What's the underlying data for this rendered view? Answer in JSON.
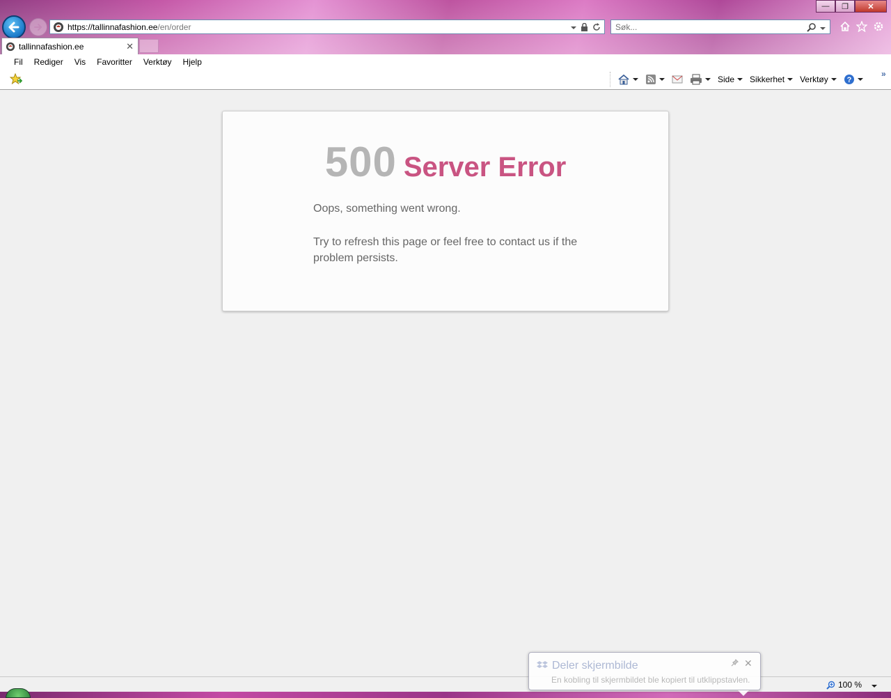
{
  "window": {
    "minimize_glyph": "—",
    "restore_glyph": "❐",
    "close_glyph": "✕"
  },
  "addressbar": {
    "url_host": "https://tallinnafashion.ee",
    "url_path": "/en/order"
  },
  "search": {
    "placeholder": "Søk..."
  },
  "tab": {
    "title": "tallinnafashion.ee",
    "close_glyph": "✕"
  },
  "menubar": {
    "items": [
      "Fil",
      "Rediger",
      "Vis",
      "Favoritter",
      "Verktøy",
      "Hjelp"
    ]
  },
  "commandbar": {
    "side": "Side",
    "security": "Sikkerhet",
    "tools": "Verktøy",
    "more_glyph": "»"
  },
  "page": {
    "error_code": "500",
    "error_title": "Server Error",
    "message_1": "Oops, something went wrong.",
    "message_2": "Try to refresh this page or feel free to contact us if the problem persists."
  },
  "statusbar": {
    "zoom": "100 %"
  },
  "toast": {
    "title": "Deler skjermbilde",
    "body": "En kobling til skjermbildet ble kopiert til utklippstavlen.",
    "close_glyph": "✕"
  },
  "colors": {
    "accent_pink": "#c95482",
    "error_code_gray": "#b5b5b5",
    "text_gray": "#666666",
    "page_bg": "#f0f0f0"
  },
  "icons": [
    "back-icon",
    "forward-icon",
    "site-icon",
    "dropdown-icon",
    "lock-icon",
    "refresh-icon",
    "search-icon",
    "home-icon",
    "favorites-star-icon",
    "gear-icon",
    "add-favorites-icon",
    "feeds-icon",
    "mail-icon",
    "print-icon",
    "help-icon",
    "zoom-icon",
    "dropbox-icon",
    "pin-icon"
  ]
}
